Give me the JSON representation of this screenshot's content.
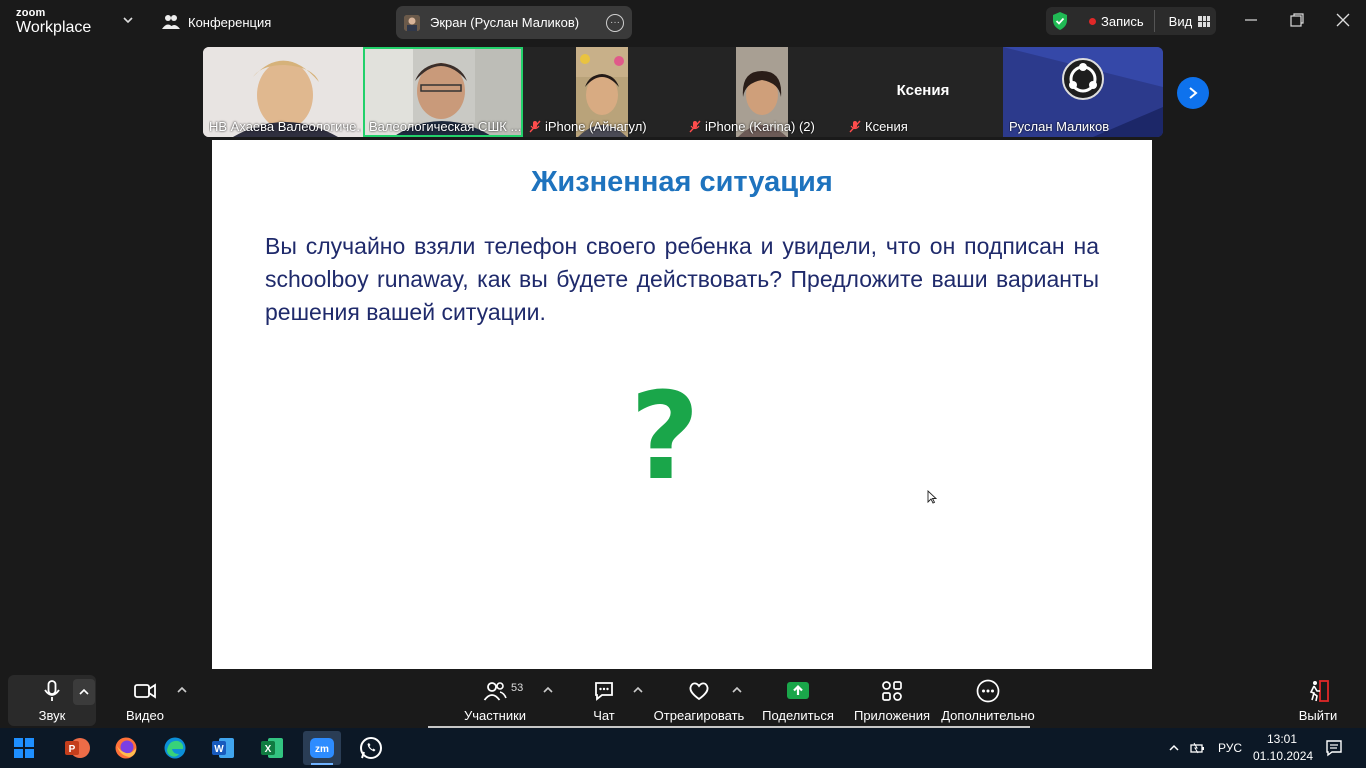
{
  "app": {
    "logo_top": "zoom",
    "logo_bottom": "Workplace"
  },
  "header": {
    "conference_label": "Конференция",
    "screen_share_label": "Экран (Руслан Маликов)",
    "recording_label": "Запись",
    "view_label": "Вид"
  },
  "participants_strip": [
    {
      "name": "НВ Ахаева Валеологиче...",
      "muted": false,
      "active": false,
      "has_video": true
    },
    {
      "name": "Валеологическая СШК ...",
      "muted": false,
      "active": true,
      "has_video": true
    },
    {
      "name": "iPhone (Айнагул)",
      "muted": true,
      "active": false,
      "has_video": true
    },
    {
      "name": "iPhone (Karina) (2)",
      "muted": true,
      "active": false,
      "has_video": true
    },
    {
      "name": "Ксения",
      "muted": true,
      "active": false,
      "has_video": false,
      "center_label": "Ксения"
    },
    {
      "name": "Руслан Маликов",
      "muted": false,
      "active": false,
      "has_video": true
    }
  ],
  "slide": {
    "title": "Жизненная ситуация",
    "body": "Вы случайно взяли телефон своего ребенка и увидели, что он подписан на schoolboy runaway, как вы будете действовать? Предложите ваши варианты решения вашей ситуации.",
    "symbol": "?"
  },
  "toolbar": {
    "audio": "Звук",
    "video": "Видео",
    "participants": "Участники",
    "participants_count": "53",
    "chat": "Чат",
    "react": "Отреагировать",
    "share": "Поделиться",
    "apps": "Приложения",
    "more": "Дополнительно",
    "leave": "Выйти"
  },
  "taskbar": {
    "language": "РУС",
    "time": "13:01",
    "date": "01.10.2024"
  },
  "colors": {
    "accent_green": "#22d16b",
    "share_green": "#1aa64a",
    "leave_red": "#e02828",
    "next_blue": "#0e72ed",
    "slide_title": "#1e73be",
    "slide_text": "#1f2a6b"
  }
}
